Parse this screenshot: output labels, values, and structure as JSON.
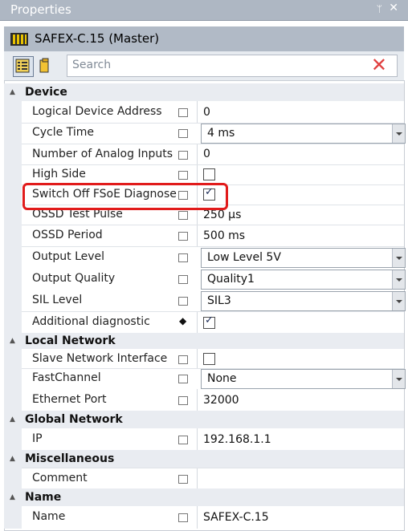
{
  "window": {
    "title": "Properties",
    "pin_glyph": "ᛘ",
    "close_glyph": "✕"
  },
  "header": {
    "device_name": "SAFEX-C.15 (Master)",
    "icon": "device-icon"
  },
  "toolbar": {
    "search_placeholder": "Search",
    "clear_glyph": "✕"
  },
  "categories": {
    "device": "Device",
    "local_network": "Local Network",
    "global_network": "Global Network",
    "misc": "Miscellaneous",
    "name": "Name"
  },
  "properties": {
    "logical_device_address": {
      "label": "Logical Device Address",
      "value": "0"
    },
    "cycle_time": {
      "label": "Cycle Time",
      "value": "4 ms"
    },
    "analog_inputs": {
      "label": "Number of Analog Inputs",
      "value": "0"
    },
    "high_side": {
      "label": "High Side",
      "checked": false
    },
    "switch_off_fsoe": {
      "label": "Switch Off FSoE Diagnose",
      "checked": true
    },
    "ossd_test_pulse": {
      "label": "OSSD Test Pulse",
      "value": "250 µs"
    },
    "ossd_period": {
      "label": "OSSD Period",
      "value": "500 ms"
    },
    "output_level": {
      "label": "Output Level",
      "value": "Low Level 5V"
    },
    "output_quality": {
      "label": "Output Quality",
      "value": "Quality1"
    },
    "sil_level": {
      "label": "SIL Level",
      "value": "SIL3"
    },
    "additional_diag": {
      "label": "Additional diagnostic",
      "checked": true,
      "icon": "◆"
    },
    "slave_net_if": {
      "label": "Slave Network Interface",
      "checked": false
    },
    "fastchannel": {
      "label": "FastChannel",
      "value": "None"
    },
    "ethernet_port": {
      "label": "Ethernet Port",
      "value": "32000"
    },
    "ip": {
      "label": "IP",
      "value": "192.168.1.1"
    },
    "comment": {
      "label": "Comment",
      "value": ""
    },
    "name": {
      "label": "Name",
      "value": "SAFEX-C.15"
    }
  },
  "colors": {
    "highlight": "#e11b1b",
    "titlebar": "#aeb7c3",
    "category_bg": "#e9ecf1"
  }
}
